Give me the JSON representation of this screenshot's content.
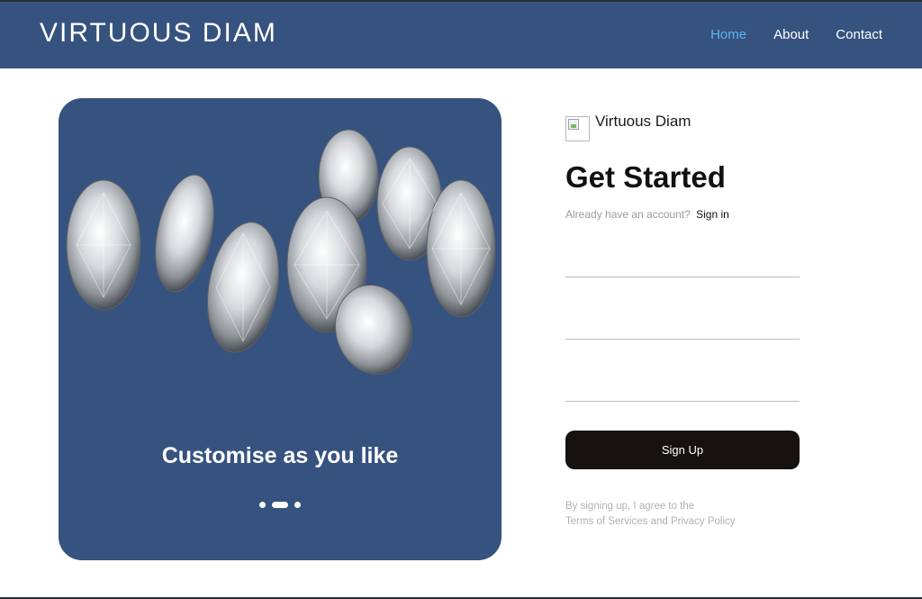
{
  "header": {
    "brand": "VIRTUOUS DIAM",
    "nav": [
      {
        "label": "Home",
        "active": true
      },
      {
        "label": "About",
        "active": false
      },
      {
        "label": "Contact",
        "active": false
      }
    ],
    "background_color": "#36527f",
    "active_link_color": "#5ab4ee"
  },
  "hero": {
    "caption": "Customise as you like",
    "image": "diamonds-image",
    "background_color": "#36527f",
    "carousel": {
      "count": 3,
      "active_index": 1
    }
  },
  "form": {
    "logo_icon": "broken-image-icon",
    "logo_text": "Virtuous Diam",
    "title": "Get Started",
    "already_text": "Already have an account?",
    "signin_label": "Sign in",
    "fields": [
      {
        "value": "",
        "placeholder": ""
      },
      {
        "value": "",
        "placeholder": ""
      },
      {
        "value": "",
        "placeholder": ""
      }
    ],
    "signup_label": "Sign Up",
    "button_color": "#151210",
    "terms_line1": "By signing up, I agree to the",
    "terms_line2": "Terms of Services and Privacy Policy"
  }
}
